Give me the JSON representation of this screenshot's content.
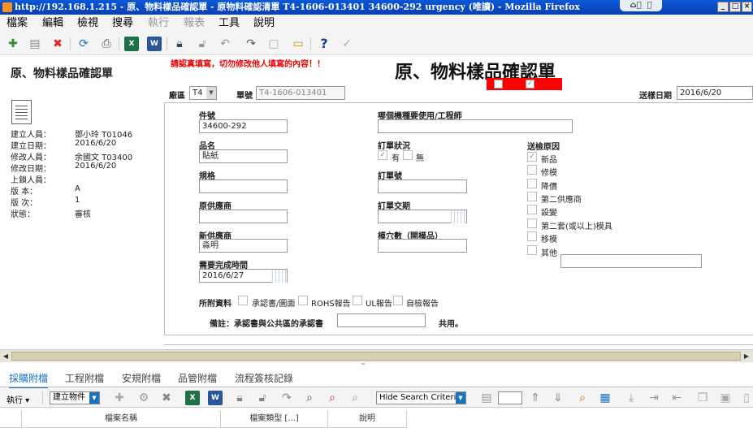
{
  "window": {
    "title": "http://192.168.1.215 - 原、物料樣品確認單 - 原物料確認清單 T4-1606-013401 34600-292 urgency (唯讀) - Mozilla Firefox"
  },
  "menu": [
    "檔案",
    "編輯",
    "檢視",
    "搜尋",
    "執行",
    "報表",
    "工具",
    "說明"
  ],
  "left_panel": {
    "title": "原、物料樣品確認單",
    "rows": [
      {
        "label": "建立人員：",
        "value": "鄧小玲 T01046"
      },
      {
        "label": "建立日期：",
        "value": "2016/6/20"
      },
      {
        "label": "修改人員：",
        "value": "余國文 T03400"
      },
      {
        "label": "修改日期：",
        "value": "2016/6/20"
      },
      {
        "label": "上鎖人員：",
        "value": ""
      },
      {
        "label": "版 本：",
        "value": "A"
      },
      {
        "label": "版 次：",
        "value": "1"
      },
      {
        "label": "狀態：",
        "value": "審核"
      }
    ]
  },
  "form": {
    "warning": "請認真填寫，切勿修改他人填寫的內容！！",
    "title": "原、物料樣品確認單",
    "factory_label": "廠區",
    "factory_value": "T4",
    "order_no_label": "單號",
    "order_no_value": "T4-1606-013401",
    "send_date_label": "送樣日期",
    "send_date_value": "2016/6/20",
    "part_no_label": "件號",
    "part_no_value": "34600-292",
    "product_name_label": "品名",
    "product_name_value": "貼紙",
    "spec_label": "規格",
    "spec_value": "",
    "orig_supplier_label": "原供應商",
    "orig_supplier_value": "",
    "new_supplier_label": "新供應商",
    "new_supplier_value": "淼明",
    "required_date_label": "需要完成時間",
    "required_date_value": "2016/6/27",
    "machine_label": "哪個機種要使用/工程師",
    "machine_value": "",
    "order_status_label": "訂單狀況",
    "order_status_yes": "有",
    "order_status_no": "無",
    "order_number_label": "訂單號",
    "order_number_value": "",
    "order_date_label": "訂單交期",
    "order_date_value": "",
    "mold_label": "模穴數（開模品）",
    "mold_value": "",
    "reason_label": "送檢原因",
    "reasons": [
      {
        "label": "新品",
        "checked": true
      },
      {
        "label": "修模",
        "checked": false
      },
      {
        "label": "降價",
        "checked": false
      },
      {
        "label": "第二供應商",
        "checked": false
      },
      {
        "label": "設變",
        "checked": false
      },
      {
        "label": "第二套(或以上)模具",
        "checked": false
      },
      {
        "label": "移模",
        "checked": false
      },
      {
        "label": "其他",
        "checked": false
      }
    ],
    "attach_label": "所附資料",
    "attachments": [
      "承認書/圖面",
      "ROHS報告",
      "UL報告",
      "自檢報告"
    ],
    "note_label": "備註：承認書與公共區的承認書",
    "note_value": "",
    "note_suffix": "共用。"
  },
  "bottom": {
    "tabs": [
      "採購附檔",
      "工程附檔",
      "安規附檔",
      "品管附檔",
      "流程簽核記錄"
    ],
    "exec_label": "執行",
    "create_item": "建立物件",
    "search_criteria": "Hide Search Criteria",
    "columns": [
      "檔案名稱",
      "檔案類型 [...]",
      "說明"
    ]
  }
}
